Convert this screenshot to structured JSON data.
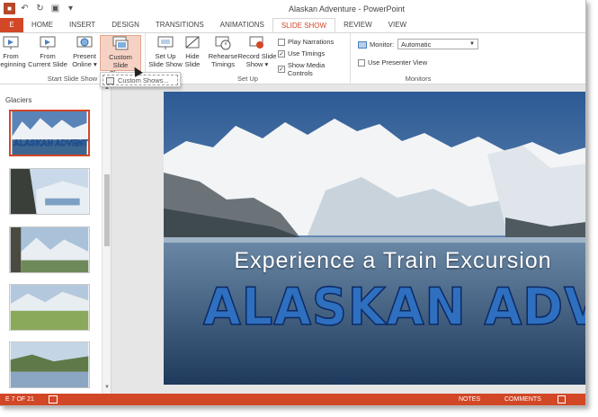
{
  "window": {
    "title": "Alaskan Adventure - PowerPoint"
  },
  "tabs": [
    {
      "label": "E"
    },
    {
      "label": "HOME"
    },
    {
      "label": "INSERT"
    },
    {
      "label": "DESIGN"
    },
    {
      "label": "TRANSITIONS"
    },
    {
      "label": "ANIMATIONS"
    },
    {
      "label": "SLIDE SHOW"
    },
    {
      "label": "REVIEW"
    },
    {
      "label": "VIEW"
    }
  ],
  "ribbon": {
    "start_group": {
      "label": "Start Slide Show",
      "from_beginning": "From\nBeginning",
      "from_current": "From\nCurrent Slide",
      "present_online": "Present\nOnline ▾",
      "custom_show": "Custom Slide\nShow ▾"
    },
    "setup_group": {
      "label": "Set Up",
      "setup_show": "Set Up\nSlide Show",
      "hide_slide": "Hide\nSlide",
      "rehearse": "Rehearse\nTimings",
      "record": "Record Slide\nShow ▾",
      "play_narrations": "Play Narrations",
      "use_timings": "Use Timings",
      "show_media_controls": "Show Media Controls"
    },
    "monitors_group": {
      "label": "Monitors",
      "monitor_label": "Monitor:",
      "monitor_value": "Automatic",
      "presenter_view": "Use Presenter View"
    }
  },
  "menu": {
    "custom_shows": "Custom Shows..."
  },
  "thumbpane": {
    "section": "Glaciers",
    "selected_thumb_text": "ALASKAN ADVENTURE"
  },
  "slide": {
    "subtitle": "Experience a Train Excursion",
    "headline": "ALASKAN ADVENTURE"
  },
  "statusbar": {
    "slide_count": "E 7 OF 21",
    "notes": "NOTES",
    "comments": "COMMENTS"
  },
  "colors": {
    "accent": "#d24726",
    "headline": "#2e6fc0"
  }
}
